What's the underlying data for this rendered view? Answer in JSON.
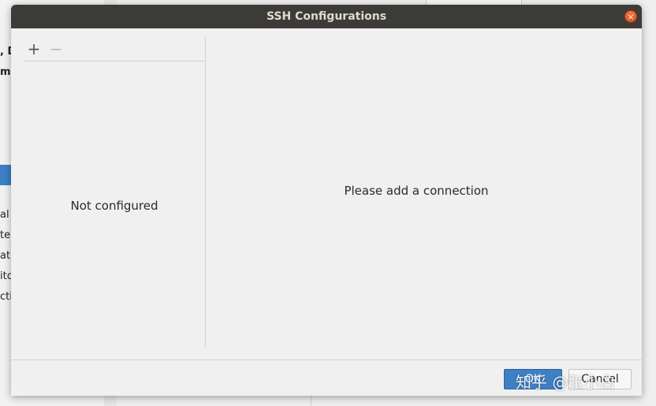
{
  "background": {
    "fragments": [
      ", D",
      "mc",
      "al I",
      "te",
      "ate",
      "itc",
      "ctio"
    ]
  },
  "dialog": {
    "title": "SSH Configurations",
    "close_glyph": "×",
    "toolbar": {
      "add_label": "+",
      "remove_label": "−"
    },
    "left_empty_text": "Not configured",
    "right_empty_text": "Please add a connection",
    "ok_label": "OK",
    "cancel_label": "Cancel"
  },
  "watermark": {
    "text": "知乎 @张小白"
  },
  "colors": {
    "titlebar": "#3c3b37",
    "accent": "#3f7fc4",
    "close": "#e25a23"
  }
}
